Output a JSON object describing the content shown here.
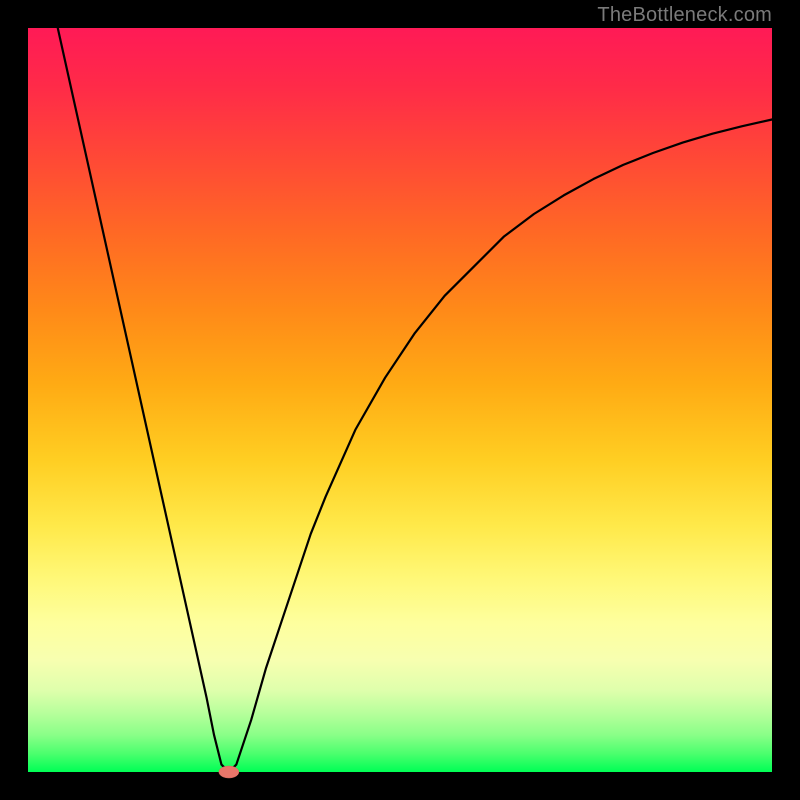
{
  "attribution": "TheBottleneck.com",
  "colors": {
    "frame": "#000000",
    "gradient_top": "#ff1a56",
    "gradient_bottom": "#00ff55",
    "curve": "#000000",
    "marker": "#e8766a"
  },
  "chart_data": {
    "type": "line",
    "title": "",
    "xlabel": "",
    "ylabel": "",
    "xlim": [
      0,
      100
    ],
    "ylim": [
      0,
      100
    ],
    "grid": false,
    "series": [
      {
        "name": "bottleneck-curve",
        "x": [
          4,
          6,
          8,
          10,
          12,
          14,
          16,
          18,
          20,
          22,
          24,
          25,
          26,
          27,
          28,
          30,
          32,
          34,
          36,
          38,
          40,
          44,
          48,
          52,
          56,
          60,
          64,
          68,
          72,
          76,
          80,
          84,
          88,
          92,
          96,
          100
        ],
        "y": [
          100,
          91,
          82,
          73,
          64,
          55,
          46,
          37,
          28,
          19,
          10,
          5,
          1,
          0,
          1,
          7,
          14,
          20,
          26,
          32,
          37,
          46,
          53,
          59,
          64,
          68,
          72,
          75,
          77.5,
          79.7,
          81.6,
          83.2,
          84.6,
          85.8,
          86.8,
          87.7
        ]
      }
    ],
    "annotations": [
      {
        "name": "minimum-marker",
        "x": 27,
        "y": 0,
        "shape": "ellipse"
      }
    ]
  }
}
